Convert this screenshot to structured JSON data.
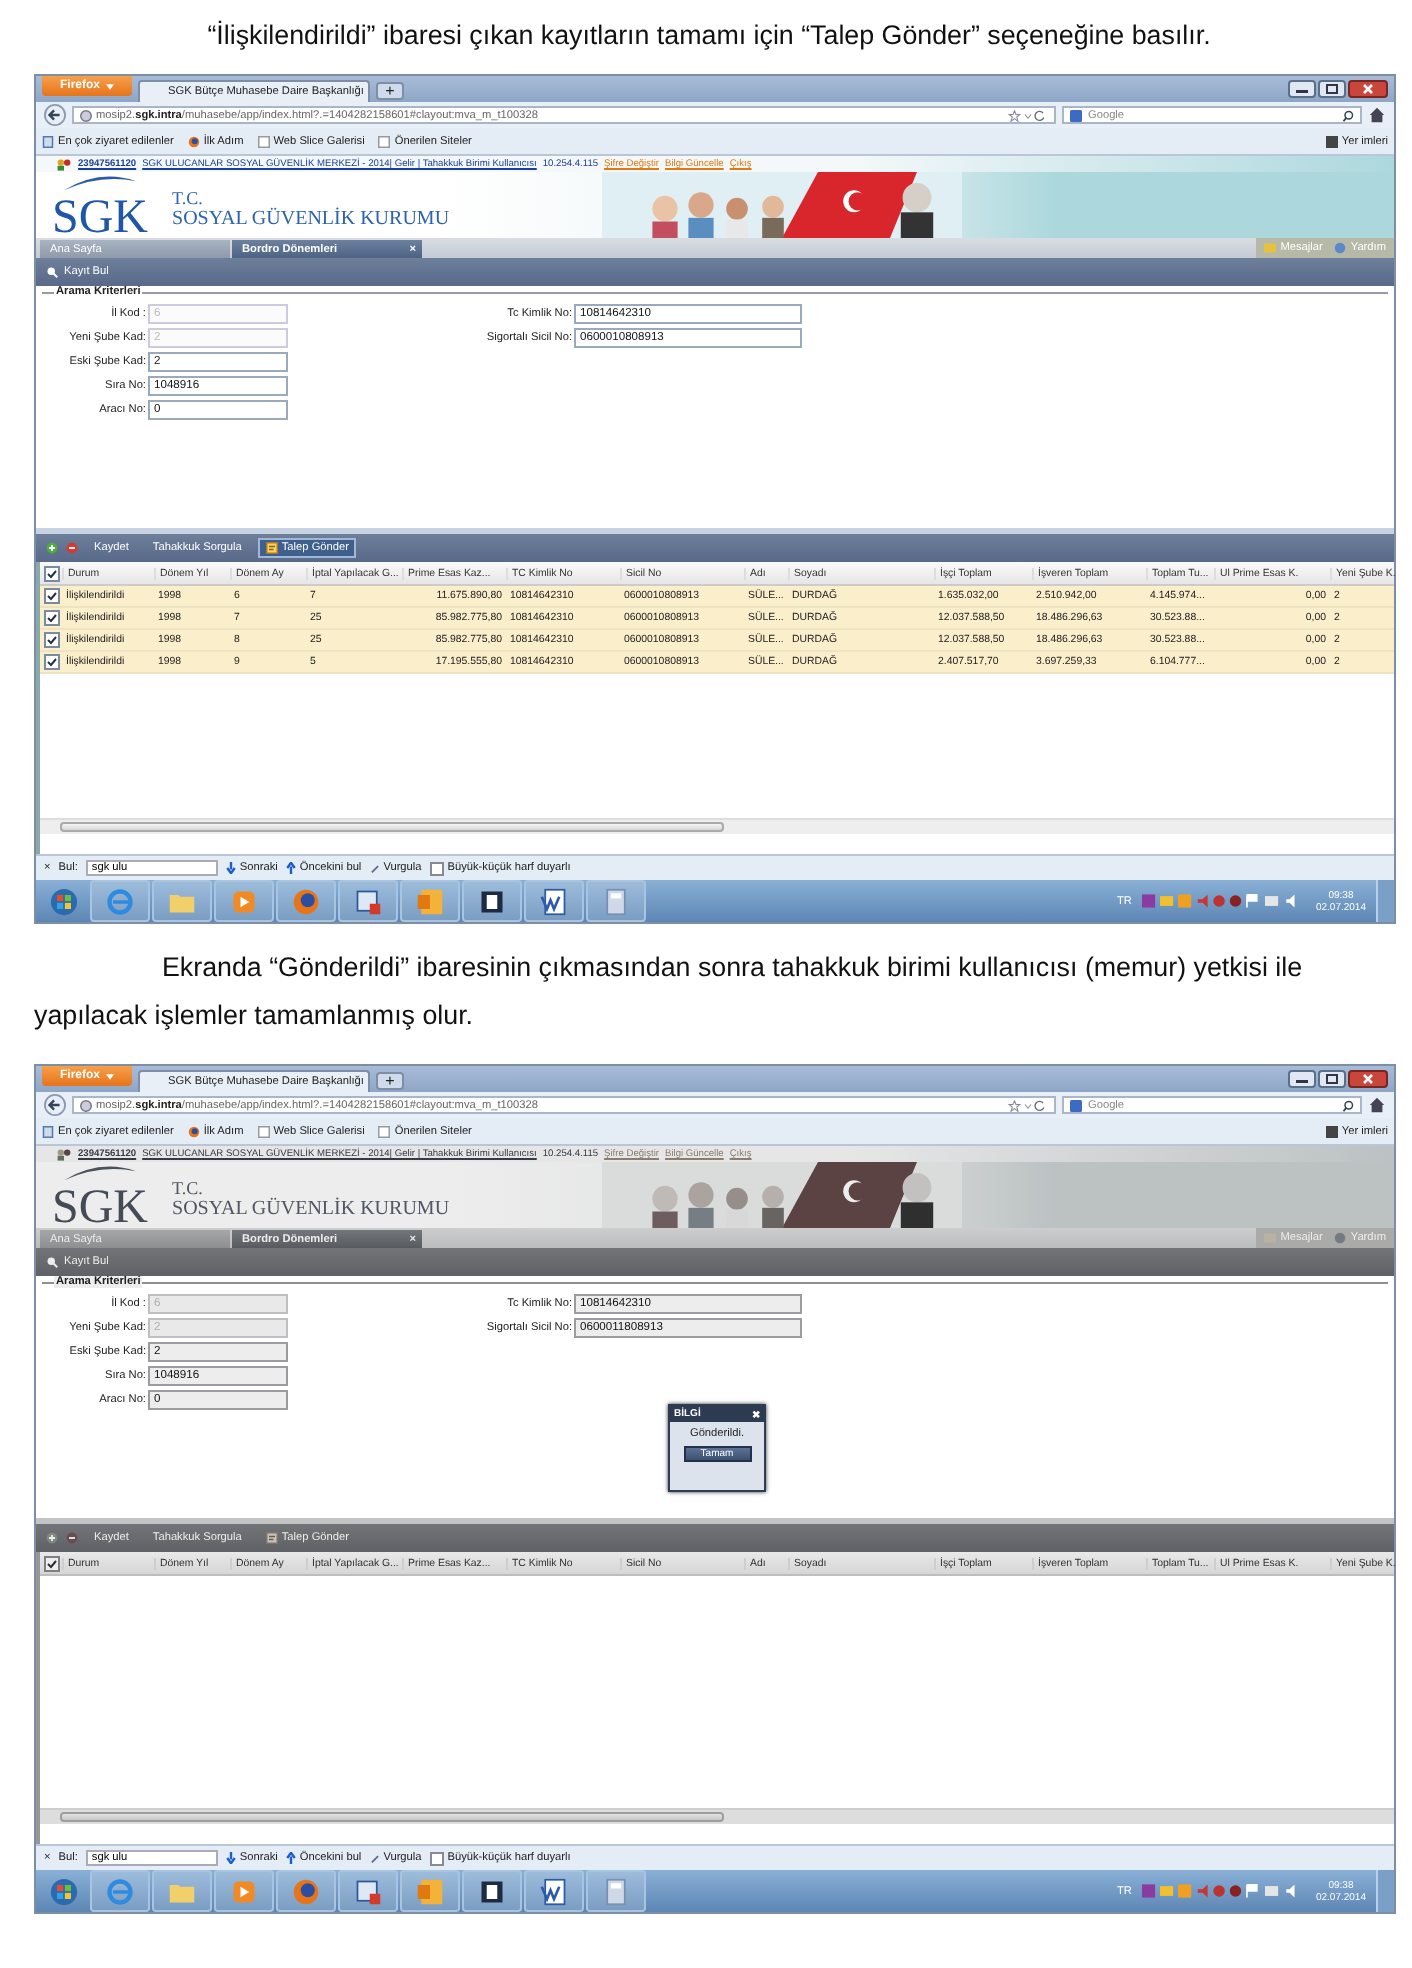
{
  "blocks": [
    {
      "kind": "paragraph",
      "indented": false,
      "text": "“İlişkilendirildi” ibaresi çıkan kayıtların tamamı için “Talep Gönder” seçeneğine basılır."
    },
    {
      "kind": "screenshot",
      "modal_mask": false,
      "browser": {
        "menu_button": "Firefox",
        "tab_title": "SGK Bütçe Muhasebe Daire Başkanlığı",
        "new_tab": "+",
        "url": "mosip2.**sgk.intra**/muhasebe/app/index.html?.=1404282158601#clayout:mva_m_t100328",
        "search_placeholder": "Google",
        "bookmarks": [
          "En çok ziyaret edilenler",
          "İlk Adım",
          "Web Slice Galerisi",
          "Önerilen Siteler"
        ],
        "bookmarks_menu": "Yer imleri"
      },
      "user_bar": [
        {
          "kind": "id",
          "text": "23947561120"
        },
        {
          "kind": "link",
          "text": "SGK ULUCANLAR SOSYAL GÜVENLİK MERKEZİ - 2014| Gelir | Tahakkuk Birimi Kullanıcısı"
        },
        {
          "kind": "plain",
          "text": "10.254.4.115"
        },
        {
          "kind": "action",
          "text": "Şifre Değiştir"
        },
        {
          "kind": "action",
          "text": "Bilgi Güncelle"
        },
        {
          "kind": "action",
          "text": "Çıkış"
        }
      ],
      "logo": {
        "mark": "SGK",
        "line1": "T.C.",
        "line2": "SOSYAL GÜVENLİK KURUMU"
      },
      "app_tabs": [
        {
          "label": "Ana Sayfa",
          "selected": false
        },
        {
          "label": "Bordro Dönemleri",
          "selected": true,
          "close": "×"
        }
      ],
      "header_links": [
        "Mesajlar",
        "Yardım"
      ],
      "panel_title": "Kayıt Bul",
      "criteria": {
        "legend": "Arama Kriterleri",
        "left": [
          {
            "label": "İl Kod :",
            "value": "6",
            "disabled": true
          },
          {
            "label": "Yeni Şube Kad:",
            "value": "2",
            "disabled": true
          },
          {
            "label": "Eski Şube Kad:",
            "value": "2",
            "disabled": false
          },
          {
            "label": "Sıra No:",
            "value": "1048916",
            "disabled": false
          },
          {
            "label": "Aracı No:",
            "value": "0",
            "disabled": false
          }
        ],
        "right": [
          {
            "label": "Tc Kimlik No:",
            "value": "10814642310",
            "disabled": false
          },
          {
            "label": "Sigortalı Sicil No:",
            "value": "0600010808913",
            "disabled": false
          }
        ]
      },
      "toolbar": [
        {
          "kind": "text",
          "label": "Kaydet",
          "pressed": false
        },
        {
          "kind": "text",
          "label": "Tahakkuk Sorgula",
          "pressed": false
        },
        {
          "kind": "icon-text",
          "label": "Talep Gönder",
          "pressed": true
        }
      ],
      "table": {
        "header_checked": true,
        "columns": [
          "Durum",
          "Dönem Yıl",
          "Dönem Ay",
          "İptal Yapılacak G...",
          "Prime Esas Kaz...",
          "TC Kimlik No",
          "Sicil No",
          "Adı",
          "Soyadı",
          "İşçi Toplam",
          "İşveren Toplam",
          "Toplam Tu...",
          "Ul Prime Esas K.",
          "Yeni Şube K."
        ],
        "rows": [
          {
            "checked": true,
            "selected": true,
            "cells": [
              "İlişkilendirildi",
              "1998",
              "6",
              "7",
              "11.675.890,80",
              "10814642310",
              "0600010808913",
              "SÜLE...",
              "DURDAĞ",
              "1.635.032,00",
              "2.510.942,00",
              "4.145.974...",
              "0,00",
              "2"
            ]
          },
          {
            "checked": true,
            "selected": true,
            "cells": [
              "İlişkilendirildi",
              "1998",
              "7",
              "25",
              "85.982.775,80",
              "10814642310",
              "0600010808913",
              "SÜLE...",
              "DURDAĞ",
              "12.037.588,50",
              "18.486.296,63",
              "30.523.88...",
              "0,00",
              "2"
            ]
          },
          {
            "checked": true,
            "selected": true,
            "cells": [
              "İlişkilendirildi",
              "1998",
              "8",
              "25",
              "85.982.775,80",
              "10814642310",
              "0600010808913",
              "SÜLE...",
              "DURDAĞ",
              "12.037.588,50",
              "18.486.296,63",
              "30.523.88...",
              "0,00",
              "2"
            ]
          },
          {
            "checked": true,
            "selected": true,
            "cells": [
              "İlişkilendirildi",
              "1998",
              "9",
              "5",
              "17.195.555,80",
              "10814642310",
              "0600010808913",
              "SÜLE...",
              "DURDAĞ",
              "2.407.517,70",
              "3.697.259,33",
              "6.104.777...",
              "0,00",
              "2"
            ]
          }
        ]
      },
      "find_bar": {
        "close": "×",
        "label": "Bul:",
        "value": "sgk ulu",
        "next": "Sonraki",
        "prev": "Öncekini bul",
        "highlight": "Vurgula",
        "match_case": {
          "label": "Büyük-küçük harf duyarlı",
          "checked": false
        }
      },
      "taskbar": {
        "lang": "TR",
        "time": "09:38",
        "date": "02.07.2014"
      }
    },
    {
      "kind": "paragraph",
      "indented": true,
      "text": "Ekranda “Gönderildi” ibaresinin çıkmasından sonra tahakkuk birimi kullanıcısı (memur) yetkisi ile yapılacak işlemler tamamlanmış olur."
    },
    {
      "kind": "screenshot",
      "modal_mask": true,
      "browser": {
        "menu_button": "Firefox",
        "tab_title": "SGK Bütçe Muhasebe Daire Başkanlığı",
        "new_tab": "+",
        "url": "mosip2.**sgk.intra**/muhasebe/app/index.html?.=1404282158601#clayout:mva_m_t100328",
        "search_placeholder": "Google",
        "bookmarks": [
          "En çok ziyaret edilenler",
          "İlk Adım",
          "Web Slice Galerisi",
          "Önerilen Siteler"
        ],
        "bookmarks_menu": "Yer imleri"
      },
      "user_bar": [
        {
          "kind": "id",
          "text": "23947561120"
        },
        {
          "kind": "link",
          "text": "SGK ULUCANLAR SOSYAL GÜVENLİK MERKEZİ - 2014| Gelir | Tahakkuk Birimi Kullanıcısı"
        },
        {
          "kind": "plain",
          "text": "10.254.4.115"
        },
        {
          "kind": "action",
          "text": "Şifre Değiştir"
        },
        {
          "kind": "action",
          "text": "Bilgi Güncelle"
        },
        {
          "kind": "action",
          "text": "Çıkış"
        }
      ],
      "logo": {
        "mark": "SGK",
        "line1": "T.C.",
        "line2": "SOSYAL GÜVENLİK KURUMU"
      },
      "app_tabs": [
        {
          "label": "Ana Sayfa",
          "selected": false
        },
        {
          "label": "Bordro Dönemleri",
          "selected": true,
          "close": "×"
        }
      ],
      "header_links": [
        "Mesajlar",
        "Yardım"
      ],
      "panel_title": "Kayıt Bul",
      "criteria": {
        "legend": "Arama Kriterleri",
        "left": [
          {
            "label": "İl Kod :",
            "value": "6",
            "disabled": true
          },
          {
            "label": "Yeni Şube Kad:",
            "value": "2",
            "disabled": true
          },
          {
            "label": "Eski Şube Kad:",
            "value": "2",
            "disabled": false
          },
          {
            "label": "Sıra No:",
            "value": "1048916",
            "disabled": false
          },
          {
            "label": "Aracı No:",
            "value": "0",
            "disabled": false
          }
        ],
        "right": [
          {
            "label": "Tc Kimlik No:",
            "value": "10814642310",
            "disabled": false
          },
          {
            "label": "Sigortalı Sicil No:",
            "value": "0600011808913",
            "disabled": false
          }
        ]
      },
      "toolbar": [
        {
          "kind": "text",
          "label": "Kaydet",
          "pressed": false
        },
        {
          "kind": "text",
          "label": "Tahakkuk Sorgula",
          "pressed": false
        },
        {
          "kind": "icon-text",
          "label": "Talep Gönder",
          "pressed": false
        }
      ],
      "table": {
        "header_checked": true,
        "columns": [
          "Durum",
          "Dönem Yıl",
          "Dönem Ay",
          "İptal Yapılacak G...",
          "Prime Esas Kaz...",
          "TC Kimlik No",
          "Sicil No",
          "Adı",
          "Soyadı",
          "İşçi Toplam",
          "İşveren Toplam",
          "Toplam Tu...",
          "Ul Prime Esas K.",
          "Yeni Şube K."
        ]
      },
      "dialog": {
        "title": "BİLGİ",
        "close": "✖",
        "message": "Gönderildi.",
        "button": "Tamam"
      },
      "find_bar": {
        "close": "×",
        "label": "Bul:",
        "value": "sgk ulu",
        "next": "Sonraki",
        "prev": "Öncekini bul",
        "highlight": "Vurgula",
        "match_case": {
          "label": "Büyük-küçük harf duyarlı",
          "checked": false
        }
      },
      "taskbar": {
        "lang": "TR",
        "time": "09:38",
        "date": "02.07.2014"
      }
    }
  ]
}
